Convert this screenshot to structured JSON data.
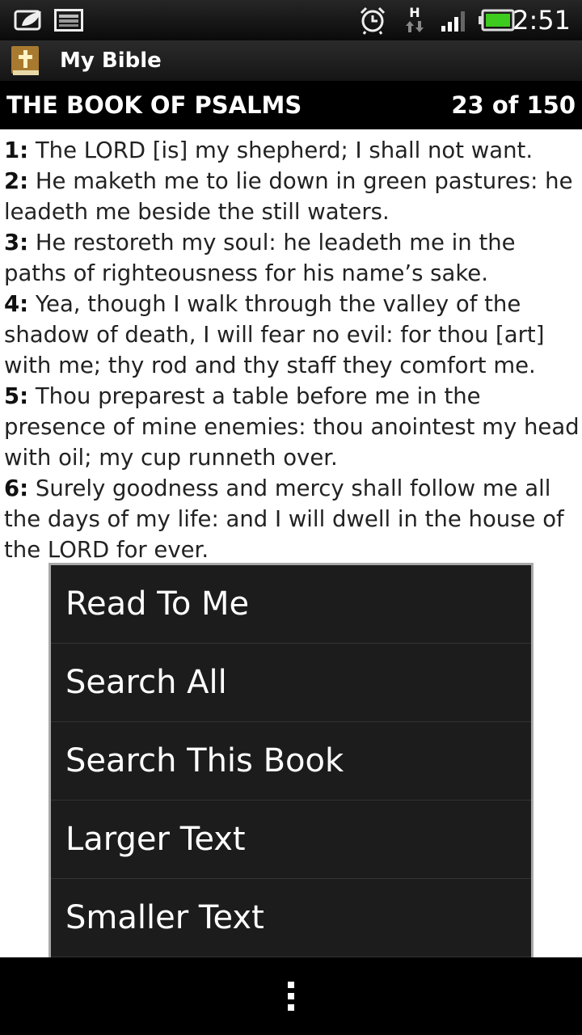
{
  "status_bar": {
    "time": "2:51",
    "network_label": "H",
    "icons": [
      "notification-leaf-icon",
      "gallery-icon",
      "alarm-clock-icon",
      "data-transfer-icon",
      "signal-strength-icon",
      "battery-icon"
    ],
    "battery_color": "#3ecb1f"
  },
  "action_bar": {
    "app_title": "My Bible",
    "app_icon": "bible-icon"
  },
  "book_header": {
    "title": "THE BOOK OF PSALMS",
    "chapter_indicator": "23 of 150"
  },
  "verses": [
    {
      "num": "1:",
      "text": " The LORD [is] my shepherd; I shall not want."
    },
    {
      "num": "2:",
      "text": " He maketh me to lie down in green pastures: he leadeth me beside the still waters."
    },
    {
      "num": "3:",
      "text": " He restoreth my soul: he leadeth me in the paths of righteousness for his name’s sake."
    },
    {
      "num": "4:",
      "text": " Yea, though I walk through the valley of the shadow of death, I will fear no evil: for thou [art] with me; thy rod and thy staff they comfort me."
    },
    {
      "num": "5:",
      "text": " Thou preparest a table before me in the presence of mine enemies: thou anointest my head with oil; my cup runneth over."
    },
    {
      "num": "6:",
      "text": " Surely goodness and mercy shall follow me all the days of my life: and I will dwell in the house of the LORD for ever."
    }
  ],
  "menu": {
    "items": [
      "Read To Me",
      "Search All",
      "Search This Book",
      "Larger Text",
      "Smaller Text"
    ]
  },
  "nav_bar": {
    "overflow_icon": "overflow-menu-icon"
  }
}
